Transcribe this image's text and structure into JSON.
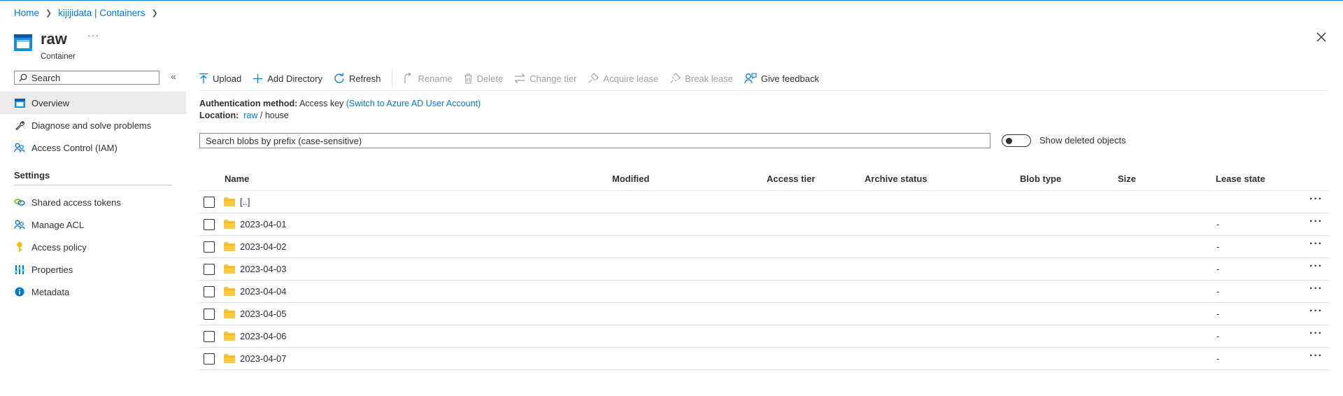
{
  "breadcrumb": {
    "home": "Home",
    "parent": "kijijidata | Containers"
  },
  "header": {
    "title": "raw",
    "subtitle": "Container",
    "more": "···"
  },
  "sidebar": {
    "search_placeholder": "Search",
    "collapse": "«",
    "items": [
      {
        "label": "Overview",
        "icon": "container-icon"
      },
      {
        "label": "Diagnose and solve problems",
        "icon": "wrench-icon"
      },
      {
        "label": "Access Control (IAM)",
        "icon": "people-icon"
      }
    ],
    "settings_title": "Settings",
    "settings_items": [
      {
        "label": "Shared access tokens",
        "icon": "link-icon"
      },
      {
        "label": "Manage ACL",
        "icon": "people-icon"
      },
      {
        "label": "Access policy",
        "icon": "key-icon"
      },
      {
        "label": "Properties",
        "icon": "sliders-icon"
      },
      {
        "label": "Metadata",
        "icon": "info-icon"
      }
    ]
  },
  "toolbar": {
    "upload": "Upload",
    "add_directory": "Add Directory",
    "refresh": "Refresh",
    "rename": "Rename",
    "delete": "Delete",
    "change_tier": "Change tier",
    "acquire_lease": "Acquire lease",
    "break_lease": "Break lease",
    "give_feedback": "Give feedback"
  },
  "info": {
    "auth_label": "Authentication method:",
    "auth_value": "Access key",
    "auth_link": "(Switch to Azure AD User Account)",
    "location_label": "Location:",
    "location_container": "raw",
    "location_sep": "/",
    "location_path": "house"
  },
  "blob_search_placeholder": "Search blobs by prefix (case-sensitive)",
  "show_deleted_label": "Show deleted objects",
  "columns": {
    "name": "Name",
    "modified": "Modified",
    "access_tier": "Access tier",
    "archive_status": "Archive status",
    "blob_type": "Blob type",
    "size": "Size",
    "lease_state": "Lease state"
  },
  "rows": [
    {
      "name": "[..]",
      "lease": ""
    },
    {
      "name": "2023-04-01",
      "lease": "-"
    },
    {
      "name": "2023-04-02",
      "lease": "-"
    },
    {
      "name": "2023-04-03",
      "lease": "-"
    },
    {
      "name": "2023-04-04",
      "lease": "-"
    },
    {
      "name": "2023-04-05",
      "lease": "-"
    },
    {
      "name": "2023-04-06",
      "lease": "-"
    },
    {
      "name": "2023-04-07",
      "lease": "-"
    }
  ],
  "row_more": "···",
  "colors": {
    "accent": "#0078d4",
    "folder": "#ffc83d"
  }
}
